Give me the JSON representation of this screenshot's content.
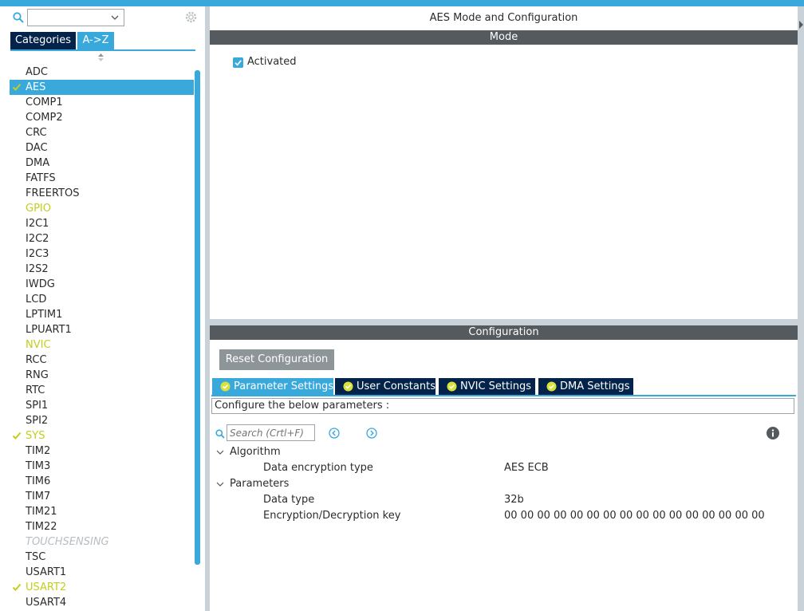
{
  "left_panel": {
    "search": {
      "value": "",
      "placeholder": ""
    },
    "tabs": {
      "categories": "Categories",
      "a_to_z": "A->Z"
    },
    "items": [
      {
        "label": "ADC",
        "state": "normal"
      },
      {
        "label": "AES",
        "state": "selected"
      },
      {
        "label": "COMP1",
        "state": "normal"
      },
      {
        "label": "COMP2",
        "state": "normal"
      },
      {
        "label": "CRC",
        "state": "normal"
      },
      {
        "label": "DAC",
        "state": "normal"
      },
      {
        "label": "DMA",
        "state": "normal"
      },
      {
        "label": "FATFS",
        "state": "normal"
      },
      {
        "label": "FREERTOS",
        "state": "normal"
      },
      {
        "label": "GPIO",
        "state": "warn"
      },
      {
        "label": "I2C1",
        "state": "normal"
      },
      {
        "label": "I2C2",
        "state": "normal"
      },
      {
        "label": "I2C3",
        "state": "normal"
      },
      {
        "label": "I2S2",
        "state": "normal"
      },
      {
        "label": "IWDG",
        "state": "normal"
      },
      {
        "label": "LCD",
        "state": "normal"
      },
      {
        "label": "LPTIM1",
        "state": "normal"
      },
      {
        "label": "LPUART1",
        "state": "normal"
      },
      {
        "label": "NVIC",
        "state": "warn"
      },
      {
        "label": "RCC",
        "state": "normal"
      },
      {
        "label": "RNG",
        "state": "normal"
      },
      {
        "label": "RTC",
        "state": "normal"
      },
      {
        "label": "SPI1",
        "state": "normal"
      },
      {
        "label": "SPI2",
        "state": "normal"
      },
      {
        "label": "SYS",
        "state": "warn-check"
      },
      {
        "label": "TIM2",
        "state": "normal"
      },
      {
        "label": "TIM3",
        "state": "normal"
      },
      {
        "label": "TIM6",
        "state": "normal"
      },
      {
        "label": "TIM7",
        "state": "normal"
      },
      {
        "label": "TIM21",
        "state": "normal"
      },
      {
        "label": "TIM22",
        "state": "normal"
      },
      {
        "label": "TOUCHSENSING",
        "state": "disabled"
      },
      {
        "label": "TSC",
        "state": "normal"
      },
      {
        "label": "USART1",
        "state": "normal"
      },
      {
        "label": "USART2",
        "state": "warn-check"
      },
      {
        "label": "USART4",
        "state": "normal"
      }
    ]
  },
  "right_panel": {
    "title": "AES Mode and Configuration",
    "mode": {
      "header": "Mode",
      "activated_label": "Activated",
      "activated_checked": true
    },
    "configuration": {
      "header": "Configuration",
      "reset_label": "Reset Configuration",
      "tabs": [
        {
          "label": "Parameter Settings",
          "active": true
        },
        {
          "label": "User Constants",
          "active": false
        },
        {
          "label": "NVIC Settings",
          "active": false
        },
        {
          "label": "DMA Settings",
          "active": false
        }
      ],
      "hint": "Configure the below parameters :",
      "search_placeholder": "Search (Crtl+F)",
      "groups": [
        {
          "name": "Algorithm",
          "params": [
            {
              "name": "Data encryption type",
              "value": "AES ECB"
            }
          ]
        },
        {
          "name": "Parameters",
          "params": [
            {
              "name": "Data type",
              "value": "32b"
            },
            {
              "name": "Encryption/Decryption key",
              "value": "00 00 00 00 00 00 00 00 00 00 00 00 00 00 00 00"
            }
          ]
        }
      ]
    }
  },
  "colors": {
    "accent": "#39a9dc",
    "dark_navy": "#03234b",
    "section_bar": "#555a5e",
    "warn_yellow": "#c3cd1e",
    "button_gray": "#8e9599"
  },
  "icons": [
    "search-icon",
    "chevron-down-icon",
    "gear-icon",
    "sort-arrow-icon",
    "check-icon",
    "checkbox-icon",
    "ok-circle-icon",
    "prev-icon",
    "next-icon",
    "info-icon",
    "collapse-chevron-icon"
  ]
}
